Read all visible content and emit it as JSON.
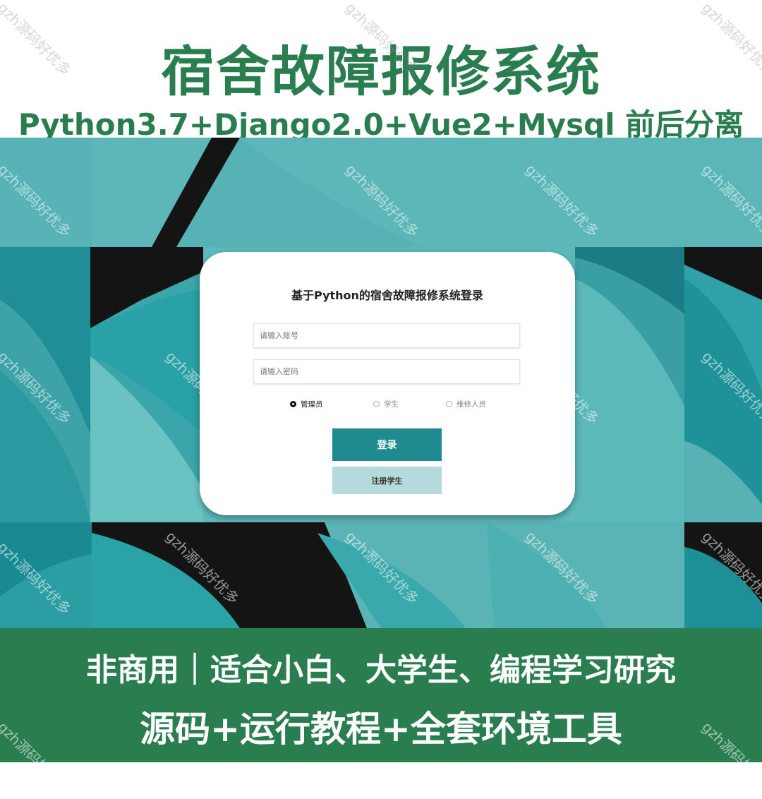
{
  "banner": {
    "title": "宿舍故障报修系统",
    "subtitle": "Python3.7+Django2.0+Vue2+Mysql 前后分离",
    "bottom_line1": "非商用｜适合小白、大学生、编程学习研究",
    "bottom_line2": "源码+运行教程+全套环境工具"
  },
  "watermark": "gzh源码好优多",
  "login": {
    "title": "基于Python的宿舍故障报修系统登录",
    "account_placeholder": "请输入账号",
    "password_placeholder": "请输入密码",
    "roles": [
      {
        "label": "管理员",
        "selected": true
      },
      {
        "label": "学生",
        "selected": false
      },
      {
        "label": "维修人员",
        "selected": false
      }
    ],
    "login_button": "登录",
    "register_button": "注册学生"
  },
  "colors": {
    "brand_green": "#2a7d4f",
    "teal_button": "#1f8a8f",
    "light_teal_button": "#b5dadb"
  }
}
